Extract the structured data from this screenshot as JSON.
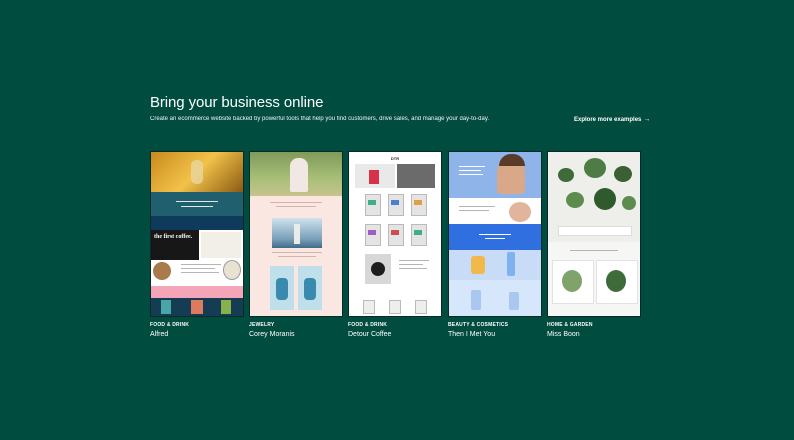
{
  "section": {
    "heading": "Bring your business online",
    "subtitle": "Create an ecommerce website backed by powerful tools that help you find customers, drive sales, and manage your day-to-day.",
    "explore_label": "Explore more examples",
    "explore_icon": "arrow-right-icon"
  },
  "examples": [
    {
      "category": "FOOD & DRINK",
      "name": "Alfred",
      "thumb_text": [
        "the first coffee."
      ]
    },
    {
      "category": "JEWELRY",
      "name": "Corey Moranis"
    },
    {
      "category": "FOOD & DRINK",
      "name": "Detour Coffee",
      "thumb_text": [
        "DTR"
      ]
    },
    {
      "category": "BEAUTY & COSMETICS",
      "name": "Then I Met You"
    },
    {
      "category": "HOME & GARDEN",
      "name": "Miss Boon"
    }
  ],
  "colors": {
    "background": "#004c3f",
    "text": "#ffffff"
  }
}
